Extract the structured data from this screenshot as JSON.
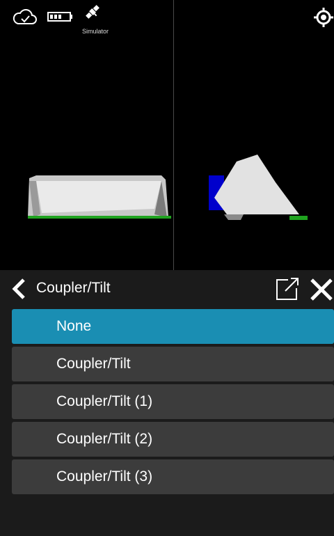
{
  "status_bar": {
    "cloud_icon": "cloud-check-icon",
    "battery_icon": "battery-icon",
    "satellite_icon": "satellite-icon",
    "simulator_label": "Simulator",
    "locate_icon": "target-icon"
  },
  "panel": {
    "title": "Coupler/Tilt",
    "back_icon": "chevron-left-icon",
    "open_icon": "open-external-icon",
    "close_icon": "close-icon",
    "items": [
      {
        "label": "None",
        "selected": true
      },
      {
        "label": "Coupler/Tilt",
        "selected": false
      },
      {
        "label": "Coupler/Tilt (1)",
        "selected": false
      },
      {
        "label": "Coupler/Tilt (2)",
        "selected": false
      },
      {
        "label": "Coupler/Tilt (3)",
        "selected": false
      }
    ]
  },
  "colors": {
    "selected": "#1a8eb3",
    "item": "#3c3c3c",
    "panel_bg": "#1b1b1b",
    "ground": "#1fa31f",
    "coupler": "#0000cc"
  }
}
